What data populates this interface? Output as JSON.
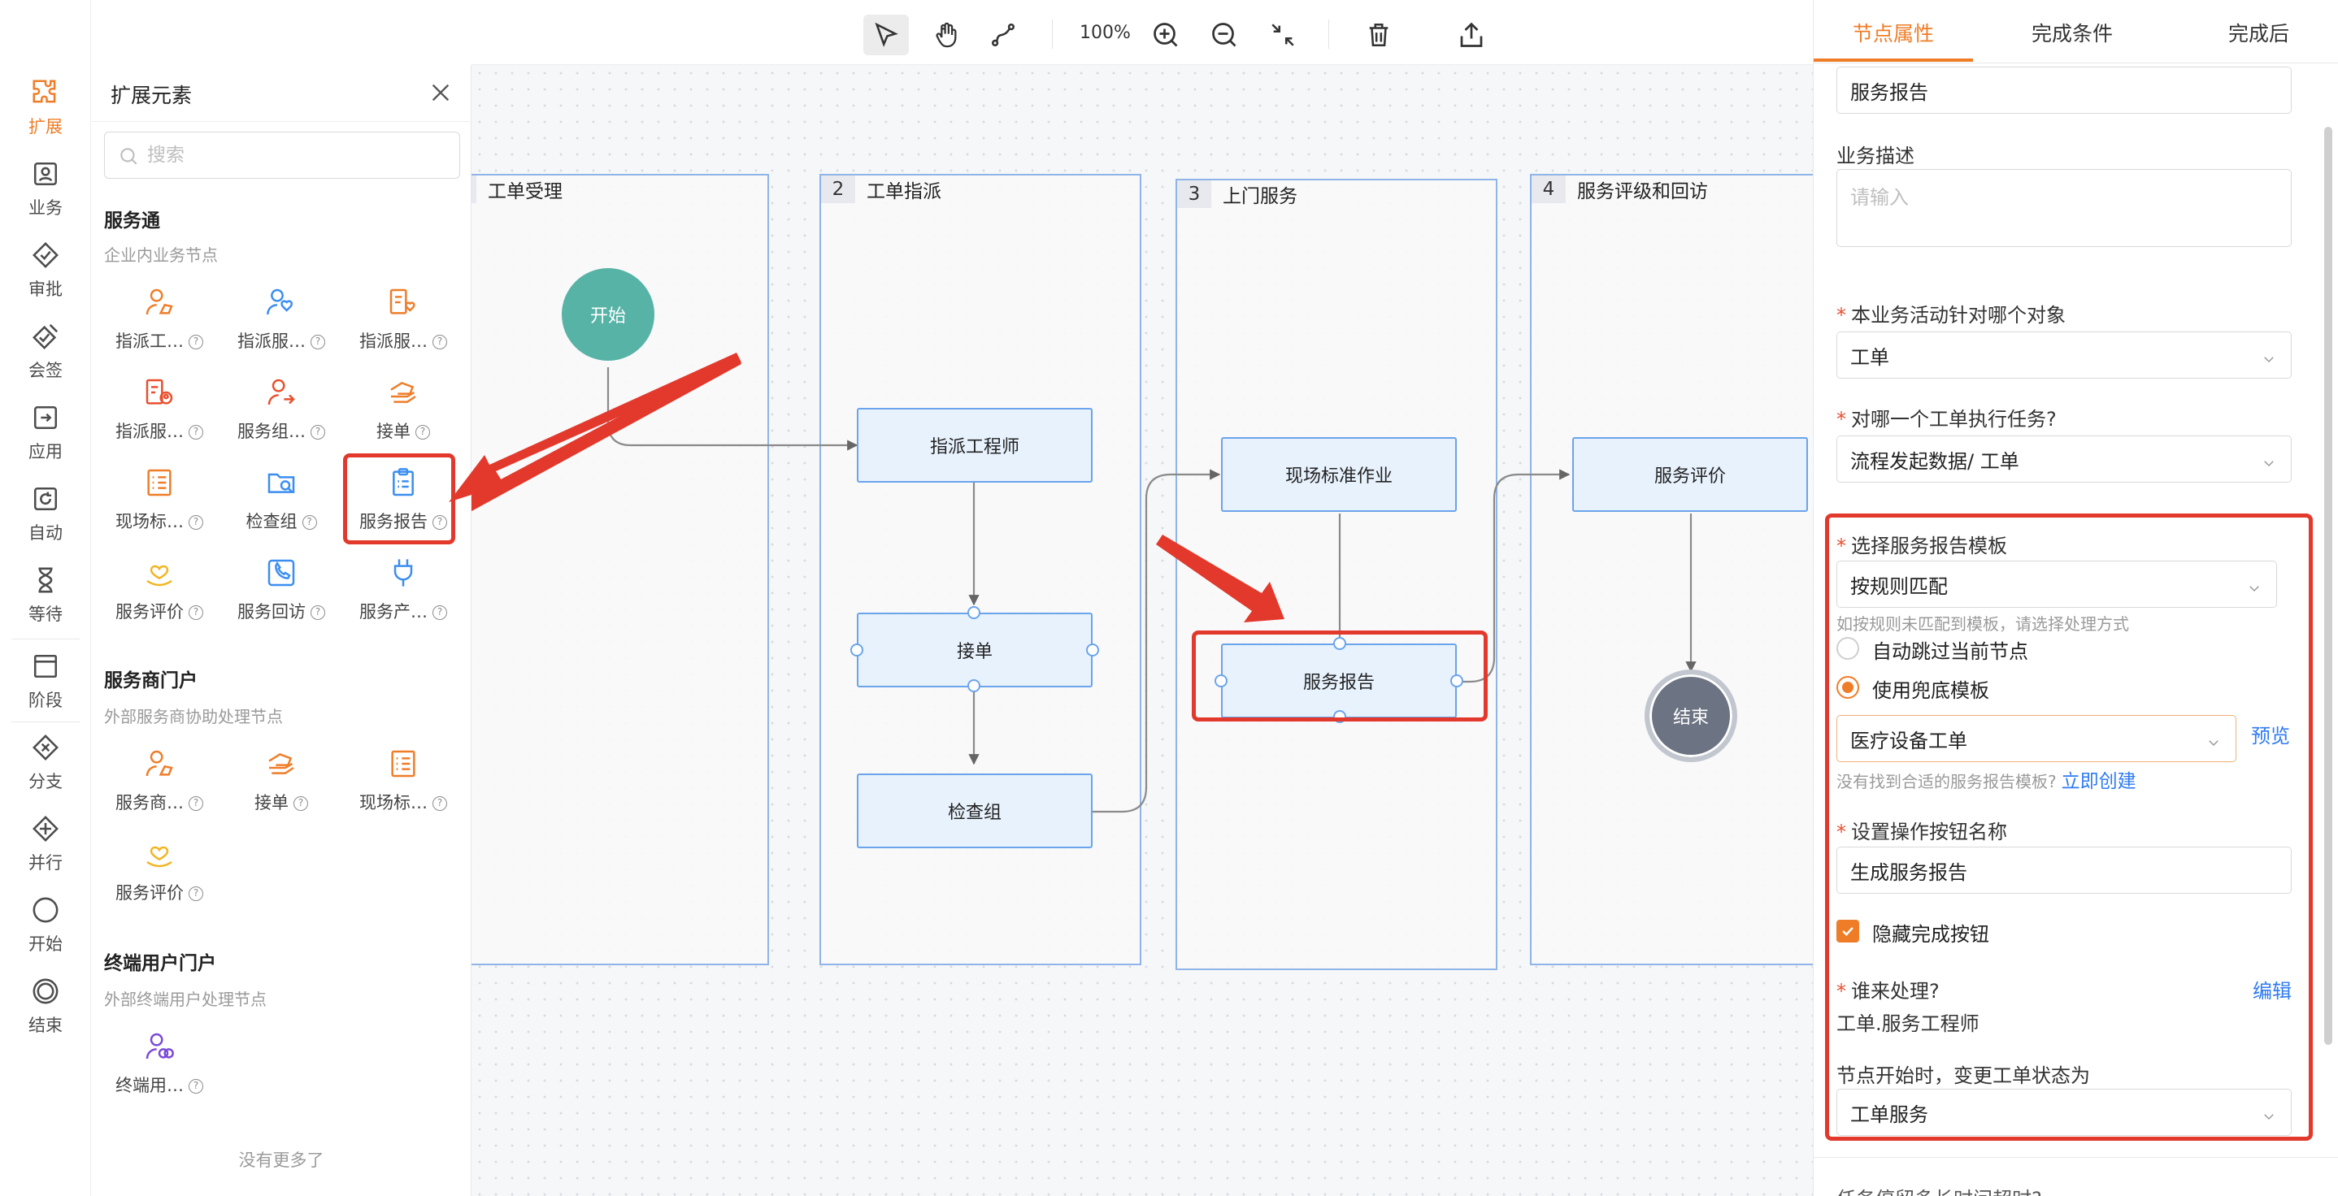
{
  "rail": {
    "items": [
      {
        "label": "扩展",
        "icon": "puzzle-icon"
      },
      {
        "label": "业务",
        "icon": "business-icon"
      },
      {
        "label": "审批",
        "icon": "approval-icon"
      },
      {
        "label": "会签",
        "icon": "countersign-icon"
      },
      {
        "label": "应用",
        "icon": "app-icon"
      },
      {
        "label": "自动",
        "icon": "auto-icon"
      },
      {
        "label": "等待",
        "icon": "hourglass-icon"
      },
      {
        "label": "阶段",
        "icon": "stage-icon"
      },
      {
        "label": "分支",
        "icon": "branch-icon"
      },
      {
        "label": "并行",
        "icon": "parallel-icon"
      },
      {
        "label": "开始",
        "icon": "start-circle-icon"
      },
      {
        "label": "结束",
        "icon": "end-circle-icon"
      }
    ]
  },
  "panel": {
    "title": "扩展元素",
    "search_placeholder": "搜索",
    "sections": [
      {
        "title": "服务通",
        "subtitle": "企业内业务节点",
        "items": [
          "指派工…",
          "指派服…",
          "指派服…",
          "指派服…",
          "服务组…",
          "接单",
          "现场标…",
          "检查组",
          "服务报告",
          "服务评价",
          "服务回访",
          "服务产…"
        ]
      },
      {
        "title": "服务商门户",
        "subtitle": "外部服务商协助处理节点",
        "items": [
          "服务商…",
          "接单",
          "现场标…",
          "服务评价"
        ]
      },
      {
        "title": "终端用户门户",
        "subtitle": "外部终端用户处理节点",
        "items": [
          "终端用…"
        ]
      }
    ],
    "no_more": "没有更多了"
  },
  "toolbar": {
    "zoom": "100%",
    "tools": [
      "select-pointer-icon",
      "hand-pan-icon",
      "connector-icon",
      "zoom-in-icon",
      "zoom-out-icon",
      "fit-collapse-icon",
      "delete-icon",
      "export-icon"
    ]
  },
  "canvas": {
    "lanes": [
      {
        "num": "",
        "title": "工单受理"
      },
      {
        "num": "2",
        "title": "工单指派"
      },
      {
        "num": "3",
        "title": "上门服务"
      },
      {
        "num": "4",
        "title": "服务评级和回访"
      }
    ],
    "start": "开始",
    "end": "结束",
    "nodes": {
      "assign_engineer": "指派工程师",
      "accept": "接单",
      "check_group": "检查组",
      "onsite": "现场标准作业",
      "report": "服务报告",
      "evaluate": "服务评价"
    },
    "colors": {
      "start": "#56b3a6",
      "end": "#6c7382",
      "node_border": "#6aa4eb",
      "highlight": "#e2392c"
    }
  },
  "props": {
    "tabs": [
      "节点属性",
      "完成条件",
      "完成后"
    ],
    "top_value": "服务报告",
    "desc_label": "业务描述",
    "desc_placeholder": "请输入",
    "object_label": "本业务活动针对哪个对象",
    "object_value": "工单",
    "target_label": "对哪一个工单执行任务?",
    "target_value": "流程发起数据/ 工单",
    "template_label": "选择服务报告模板",
    "template_value": "按规则匹配",
    "template_hint": "如按规则未匹配到模板，请选择处理方式",
    "radio_skip": "自动跳过当前节点",
    "radio_fallback": "使用兜底模板",
    "fallback_value": "医疗设备工单",
    "preview": "预览",
    "not_found": "没有找到合适的服务报告模板?",
    "create_now": "立即创建",
    "button_name_label": "设置操作按钮名称",
    "button_name_value": "生成服务报告",
    "hide_complete": "隐藏完成按钮",
    "who_label": "谁来处理?",
    "edit": "编辑",
    "who_value": "工单.服务工程师",
    "status_label": "节点开始时，变更工单状态为",
    "status_value": "工单服务",
    "bottom_cut": "任务停留多长时间超时?"
  }
}
